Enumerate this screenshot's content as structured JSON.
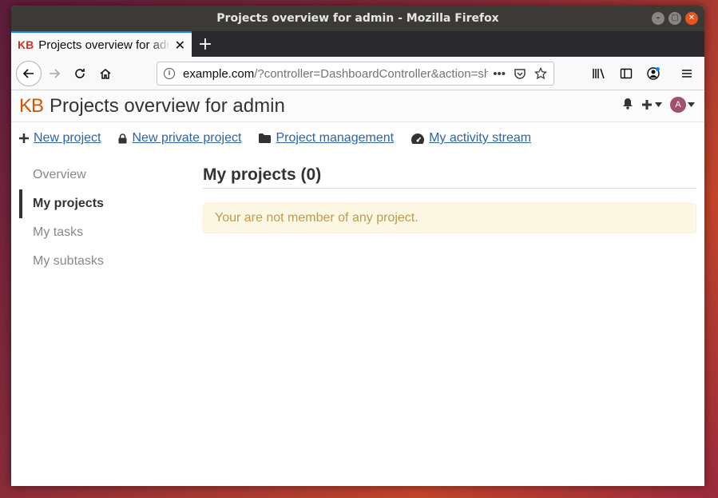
{
  "window": {
    "title": "Projects overview for admin - Mozilla Firefox"
  },
  "tab": {
    "favicon": "KB",
    "title": "Projects overview for admin",
    "close": "✕"
  },
  "newtab": "+",
  "urlbar": {
    "host": "example.com",
    "path": "/?controller=DashboardController&action=show"
  },
  "app": {
    "logo": "KB",
    "title": "Projects overview for admin",
    "avatar_letter": "A"
  },
  "actions": [
    {
      "icon": "plus-icon",
      "label": "New project"
    },
    {
      "icon": "lock-icon",
      "label": "New private project"
    },
    {
      "icon": "folder-icon",
      "label": "Project management"
    },
    {
      "icon": "dashboard-icon",
      "label": "My activity stream"
    }
  ],
  "sidebar": {
    "items": [
      {
        "label": "Overview",
        "active": false
      },
      {
        "label": "My projects",
        "active": true
      },
      {
        "label": "My tasks",
        "active": false
      },
      {
        "label": "My subtasks",
        "active": false
      }
    ]
  },
  "main": {
    "section_title": "My projects (0)",
    "alert": "Your are not member of any project."
  },
  "colors": {
    "link": "#2e64a6",
    "logo": "#d35400",
    "alert_bg": "#fcf8e3",
    "alert_text": "#c09853"
  }
}
